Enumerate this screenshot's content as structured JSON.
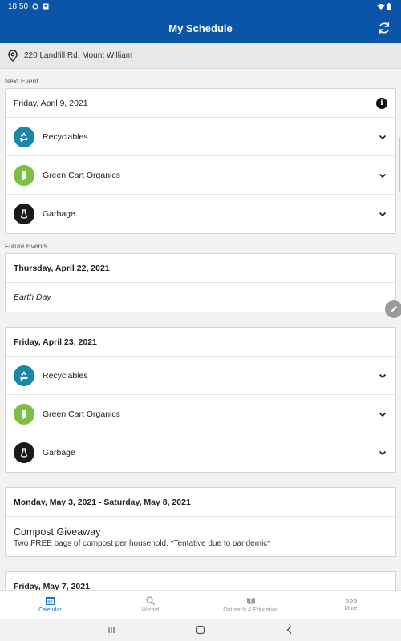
{
  "status_bar": {
    "time": "18:50"
  },
  "app_bar": {
    "title": "My Schedule"
  },
  "address": "220 Landfill Rd, Mount William",
  "sections": {
    "next_event": "Next Event",
    "future_events": "Future Events"
  },
  "next_event": {
    "date": "Friday, April 9, 2021",
    "items": [
      {
        "label": "Recyclables",
        "color": "#1a86a8",
        "icon": "recycle-icon"
      },
      {
        "label": "Green Cart Organics",
        "color": "#7ac143",
        "icon": "organics-icon"
      },
      {
        "label": "Garbage",
        "color": "#1a1a1a",
        "icon": "garbage-bag-icon"
      }
    ]
  },
  "future_events": [
    {
      "date": "Thursday, April 22, 2021",
      "event": "Earth Day"
    },
    {
      "date": "Friday, April 23, 2021",
      "items": [
        {
          "label": "Recyclables"
        },
        {
          "label": "Green Cart Organics"
        },
        {
          "label": "Garbage"
        }
      ]
    },
    {
      "date": "Monday, May 3, 2021 - Saturday, May 8, 2021",
      "title": "Compost Giveaway",
      "description": "Two FREE bags of compost per household. *Tentative due to pandemic*"
    },
    {
      "date": "Friday, May 7, 2021"
    }
  ],
  "bottom_nav": [
    {
      "label": "Calendar",
      "icon": "calendar-icon",
      "active": true
    },
    {
      "label": "Wizard",
      "icon": "search-icon",
      "active": false
    },
    {
      "label": "Outreach & Education",
      "icon": "book-icon",
      "active": false
    },
    {
      "label": "More",
      "icon": "more-icon",
      "active": false
    }
  ],
  "colors": {
    "primary": "#0b55a8",
    "accent": "#1e74c7"
  }
}
